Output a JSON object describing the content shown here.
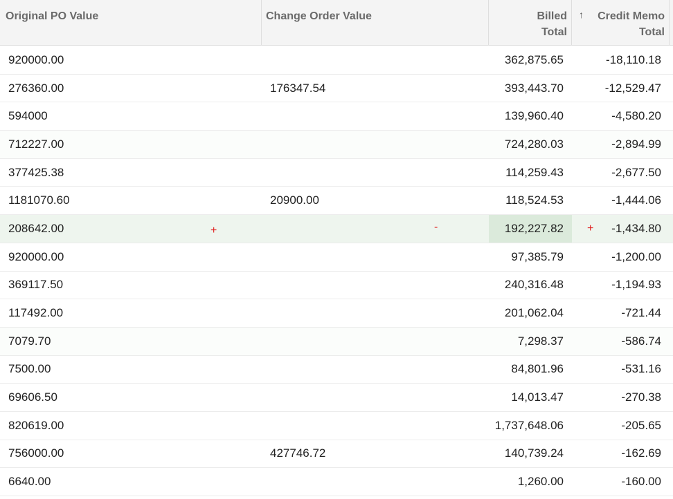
{
  "columns": {
    "original_po": "Original PO Value",
    "change_order": "Change Order Value",
    "billed_line1": "Billed",
    "billed_line2": "Total",
    "credit_line1": "Credit Memo",
    "credit_line2": "Total",
    "sort_indicator": "↑"
  },
  "markers": {
    "expand_symbol": "+",
    "collapse_symbol": "-",
    "credit_expand_symbol": "+"
  },
  "rows": [
    {
      "po": "920000.00",
      "co": "",
      "billed": "362,875.65",
      "credit": "-18,110.18"
    },
    {
      "po": "276360.00",
      "co": "176347.54",
      "billed": "393,443.70",
      "credit": "-12,529.47"
    },
    {
      "po": "594000",
      "co": "",
      "billed": "139,960.40",
      "credit": "-4,580.20"
    },
    {
      "po": "712227.00",
      "co": "",
      "billed": "724,280.03",
      "credit": "-2,894.99"
    },
    {
      "po": "377425.38",
      "co": "",
      "billed": "114,259.43",
      "credit": "-2,677.50"
    },
    {
      "po": "1181070.60",
      "co": "20900.00",
      "billed": "118,524.53",
      "credit": "-1,444.06"
    },
    {
      "po": "208642.00",
      "co": "",
      "billed": "192,227.82",
      "credit": "-1,434.80"
    },
    {
      "po": "920000.00",
      "co": "",
      "billed": "97,385.79",
      "credit": "-1,200.00"
    },
    {
      "po": "369117.50",
      "co": "",
      "billed": "240,316.48",
      "credit": "-1,194.93"
    },
    {
      "po": "117492.00",
      "co": "",
      "billed": "201,062.04",
      "credit": "-721.44"
    },
    {
      "po": "7079.70",
      "co": "",
      "billed": "7,298.37",
      "credit": "-586.74"
    },
    {
      "po": "7500.00",
      "co": "",
      "billed": "84,801.96",
      "credit": "-531.16"
    },
    {
      "po": "69606.50",
      "co": "",
      "billed": "14,013.47",
      "credit": "-270.38"
    },
    {
      "po": "820619.00",
      "co": "",
      "billed": "1,737,648.06",
      "credit": "-205.65"
    },
    {
      "po": "756000.00",
      "co": "427746.72",
      "billed": "140,739.24",
      "credit": "-162.69"
    },
    {
      "po": "6640.00",
      "co": "",
      "billed": "1,260.00",
      "credit": "-160.00"
    }
  ]
}
